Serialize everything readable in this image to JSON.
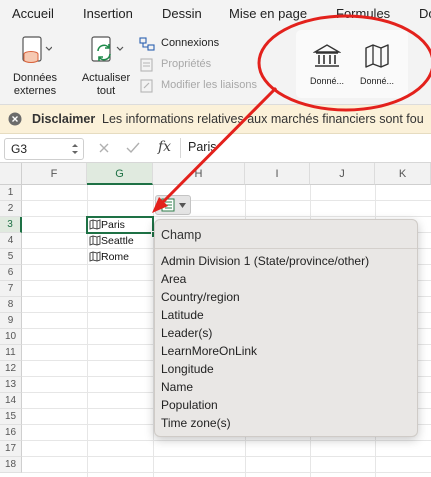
{
  "tabs": [
    "Accueil",
    "Insertion",
    "Dessin",
    "Mise en page",
    "Formules",
    "Do"
  ],
  "ribbon": {
    "donnees_externes": "Données externes",
    "actualiser_tout": "Actualiser tout",
    "connexions": "Connexions",
    "proprietes": "Propriétés",
    "modifier_liaisons": "Modifier les liaisons",
    "data_type_1": "Donné...",
    "data_type_2": "Donné..."
  },
  "disclaimer": {
    "title": "Disclaimer",
    "text": "Les informations relatives aux marchés financiers sont fou"
  },
  "formula_bar": {
    "name_box": "G3",
    "fx": "fx",
    "value": "Paris"
  },
  "grid": {
    "columns": [
      "F",
      "G",
      "H",
      "I",
      "J",
      "K"
    ],
    "selected_column": "G",
    "rows": [
      "1",
      "2",
      "3",
      "4",
      "5",
      "6",
      "7",
      "8",
      "9",
      "10",
      "11",
      "12",
      "13",
      "14",
      "15",
      "16",
      "17",
      "18"
    ],
    "selected_row": "3",
    "cells": [
      {
        "ref": "G3",
        "value": "Paris"
      },
      {
        "ref": "G4",
        "value": "Seattle"
      },
      {
        "ref": "G5",
        "value": "Rome"
      }
    ]
  },
  "field_popup": {
    "header": "Champ",
    "items": [
      "Admin Division 1 (State/province/other)",
      "Area",
      "Country/region",
      "Latitude",
      "Leader(s)",
      "LearnMoreOnLink",
      "Longitude",
      "Name",
      "Population",
      "Time zone(s)"
    ]
  },
  "colors": {
    "accent_green": "#1e7145",
    "annotation_red": "#e3211c",
    "disclaimer_bg": "#fbf1d9"
  }
}
